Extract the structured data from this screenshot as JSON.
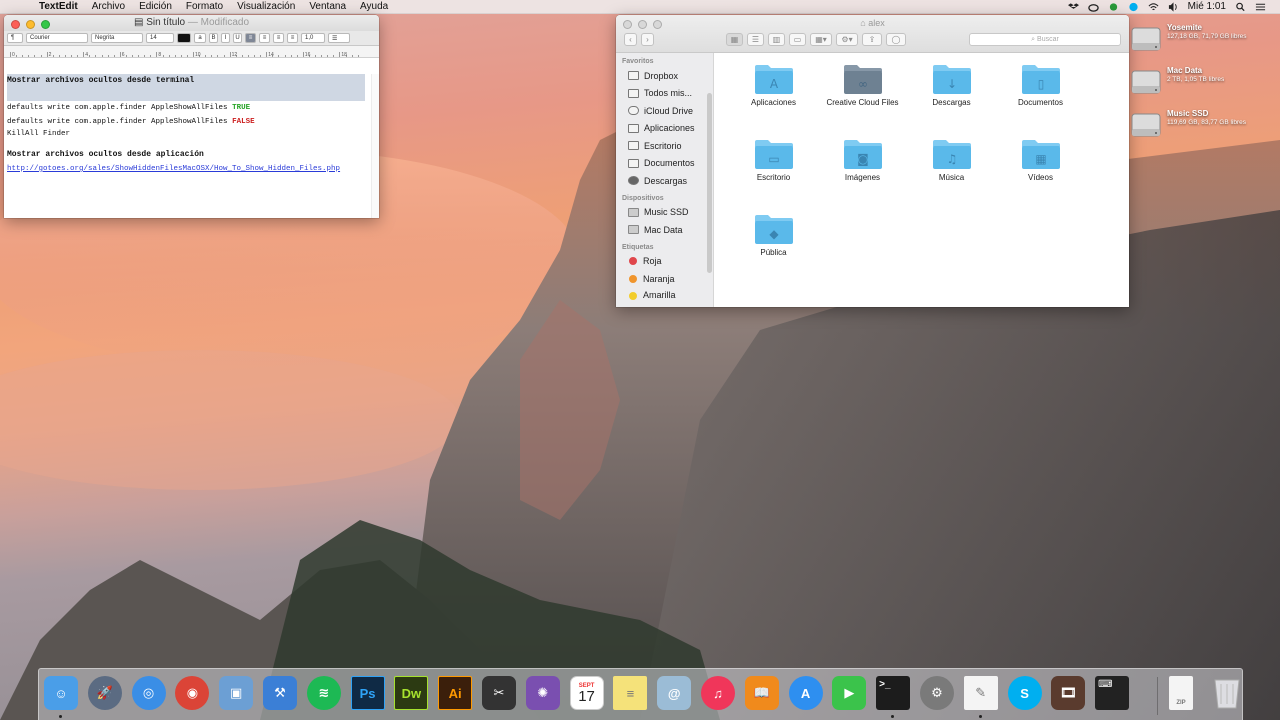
{
  "menubar": {
    "app_name": "TextEdit",
    "menus": [
      "Archivo",
      "Edición",
      "Formato",
      "Visualización",
      "Ventana",
      "Ayuda"
    ],
    "clock": "Mié 1:01"
  },
  "textedit": {
    "title": "Sin título",
    "title_status": "— Modificado",
    "toolbar": {
      "style_select": "¶",
      "font_family": "Courier",
      "font_style": "Negrita",
      "font_size": "14",
      "bold": "B",
      "italic": "I",
      "underline": "U",
      "spacing": "1,0",
      "list": "☰"
    },
    "ruler_numbers": [
      "0",
      "2",
      "4",
      "6",
      "8",
      "10",
      "12",
      "14",
      "16",
      "18"
    ],
    "heading1": "Mostrar archivos ocultos desde terminal",
    "cmd1_prefix": "defaults write com.apple.finder AppleShowAllFiles",
    "cmd1_value": "TRUE",
    "cmd2_prefix": "defaults write com.apple.finder AppleShowAllFiles",
    "cmd2_value": "FALSE",
    "cmd3": "KillAll Finder",
    "heading2": "Mostrar archivos ocultos desde aplicación",
    "link": "http://gotoes.org/sales/ShowHiddenFilesMacOSX/How_To_Show_Hidden_Files.php"
  },
  "finder": {
    "title": "alex",
    "search_placeholder": "Buscar",
    "sidebar": {
      "favorites_header": "Favoritos",
      "favorites": [
        "Dropbox",
        "Todos mis...",
        "iCloud Drive",
        "Aplicaciones",
        "Escritorio",
        "Documentos",
        "Descargas"
      ],
      "devices_header": "Dispositivos",
      "devices": [
        "Music SSD",
        "Mac Data"
      ],
      "tags_header": "Etiquetas",
      "tags": [
        {
          "label": "Roja",
          "color": "#e0464b"
        },
        {
          "label": "Naranja",
          "color": "#f0952d"
        },
        {
          "label": "Amarilla",
          "color": "#f2cd2c"
        }
      ]
    },
    "folders": [
      {
        "label": "Aplicaciones",
        "icon": "apps-folder-icon"
      },
      {
        "label": "Creative Cloud Files",
        "icon": "creative-cloud-folder-icon"
      },
      {
        "label": "Descargas",
        "icon": "downloads-folder-icon"
      },
      {
        "label": "Documentos",
        "icon": "documents-folder-icon"
      },
      {
        "label": "Escritorio",
        "icon": "desktop-folder-icon"
      },
      {
        "label": "Imágenes",
        "icon": "pictures-folder-icon"
      },
      {
        "label": "Música",
        "icon": "music-folder-icon"
      },
      {
        "label": "Vídeos",
        "icon": "movies-folder-icon"
      },
      {
        "label": "Pública",
        "icon": "public-folder-icon"
      }
    ]
  },
  "drives": [
    {
      "name": "Yosemite",
      "info": "127,18 GB, 71,79 GB libres"
    },
    {
      "name": "Mac Data",
      "info": "2 TB, 1,05 TB libres"
    },
    {
      "name": "Music SSD",
      "info": "119,69 GB, 83,77 GB libres"
    }
  ],
  "dock": {
    "calendar_month": "SEPT",
    "calendar_day": "17",
    "apps": [
      {
        "name": "Finder",
        "icon": "finder-icon",
        "color": "#4a9ee8",
        "glyph": "☺",
        "running": true
      },
      {
        "name": "Launchpad",
        "icon": "launchpad-icon",
        "color": "#5b6b82",
        "glyph": "🚀",
        "running": false
      },
      {
        "name": "Safari",
        "icon": "safari-icon",
        "color": "#3a8ee6",
        "glyph": "◎",
        "running": false
      },
      {
        "name": "Chrome",
        "icon": "chrome-icon",
        "color": "#db4437",
        "glyph": "◉",
        "running": false
      },
      {
        "name": "Preview",
        "icon": "preview-icon",
        "color": "#6c9fd4",
        "glyph": "▣",
        "running": false
      },
      {
        "name": "Xcode",
        "icon": "xcode-icon",
        "color": "#3b7fd6",
        "glyph": "⚒",
        "running": false
      },
      {
        "name": "Spotify",
        "icon": "spotify-icon",
        "color": "#1db954",
        "glyph": "≋",
        "running": false
      },
      {
        "name": "Photoshop",
        "icon": "photoshop-icon",
        "color": "#0f2a45",
        "glyph": "Ps",
        "running": false
      },
      {
        "name": "Dreamweaver",
        "icon": "dreamweaver-icon",
        "color": "#2c3a12",
        "glyph": "Dw",
        "running": false
      },
      {
        "name": "Illustrator",
        "icon": "illustrator-icon",
        "color": "#3b1f0b",
        "glyph": "Ai",
        "running": false
      },
      {
        "name": "Final Cut Pro",
        "icon": "final-cut-icon",
        "color": "#333333",
        "glyph": "✂",
        "running": false
      },
      {
        "name": "Motion",
        "icon": "motion-icon",
        "color": "#7a4fb0",
        "glyph": "✺",
        "running": false
      },
      {
        "name": "Calendar",
        "icon": "calendar-icon",
        "color": "#ffffff",
        "glyph": "",
        "running": false
      },
      {
        "name": "Notes",
        "icon": "notes-icon",
        "color": "#f5e27a",
        "glyph": "≡",
        "running": false
      },
      {
        "name": "Contacts",
        "icon": "contacts-icon",
        "color": "#9bbcd6",
        "glyph": "@",
        "running": false
      },
      {
        "name": "iTunes",
        "icon": "itunes-icon",
        "color": "#f0365a",
        "glyph": "♫",
        "running": false
      },
      {
        "name": "iBooks",
        "icon": "ibooks-icon",
        "color": "#f08a1c",
        "glyph": "📖",
        "running": false
      },
      {
        "name": "App Store",
        "icon": "app-store-icon",
        "color": "#2e8ff0",
        "glyph": "A",
        "running": false
      },
      {
        "name": "FaceTime",
        "icon": "facetime-icon",
        "color": "#3bc34b",
        "glyph": "▶",
        "running": false
      },
      {
        "name": "Terminal",
        "icon": "terminal-icon",
        "color": "#1c1c1c",
        "glyph": ">_",
        "running": true
      },
      {
        "name": "System Preferences",
        "icon": "system-preferences-icon",
        "color": "#7a7a7a",
        "glyph": "⚙",
        "running": false
      },
      {
        "name": "TextEdit",
        "icon": "textedit-icon",
        "color": "#f4f4f4",
        "glyph": "✎",
        "running": true
      },
      {
        "name": "Skype",
        "icon": "skype-icon",
        "color": "#00aff0",
        "glyph": "S",
        "running": false
      },
      {
        "name": "Photo Booth",
        "icon": "photo-booth-icon",
        "color": "#5a3b2e",
        "glyph": "🎞",
        "running": false
      },
      {
        "name": "Console",
        "icon": "console-icon",
        "color": "#222222",
        "glyph": "⌨",
        "running": false
      }
    ],
    "right_items": [
      {
        "name": "Downloads stack",
        "icon": "zip-file-icon",
        "glyph": "ZIP"
      },
      {
        "name": "Trash",
        "icon": "trash-icon",
        "glyph": ""
      }
    ]
  }
}
